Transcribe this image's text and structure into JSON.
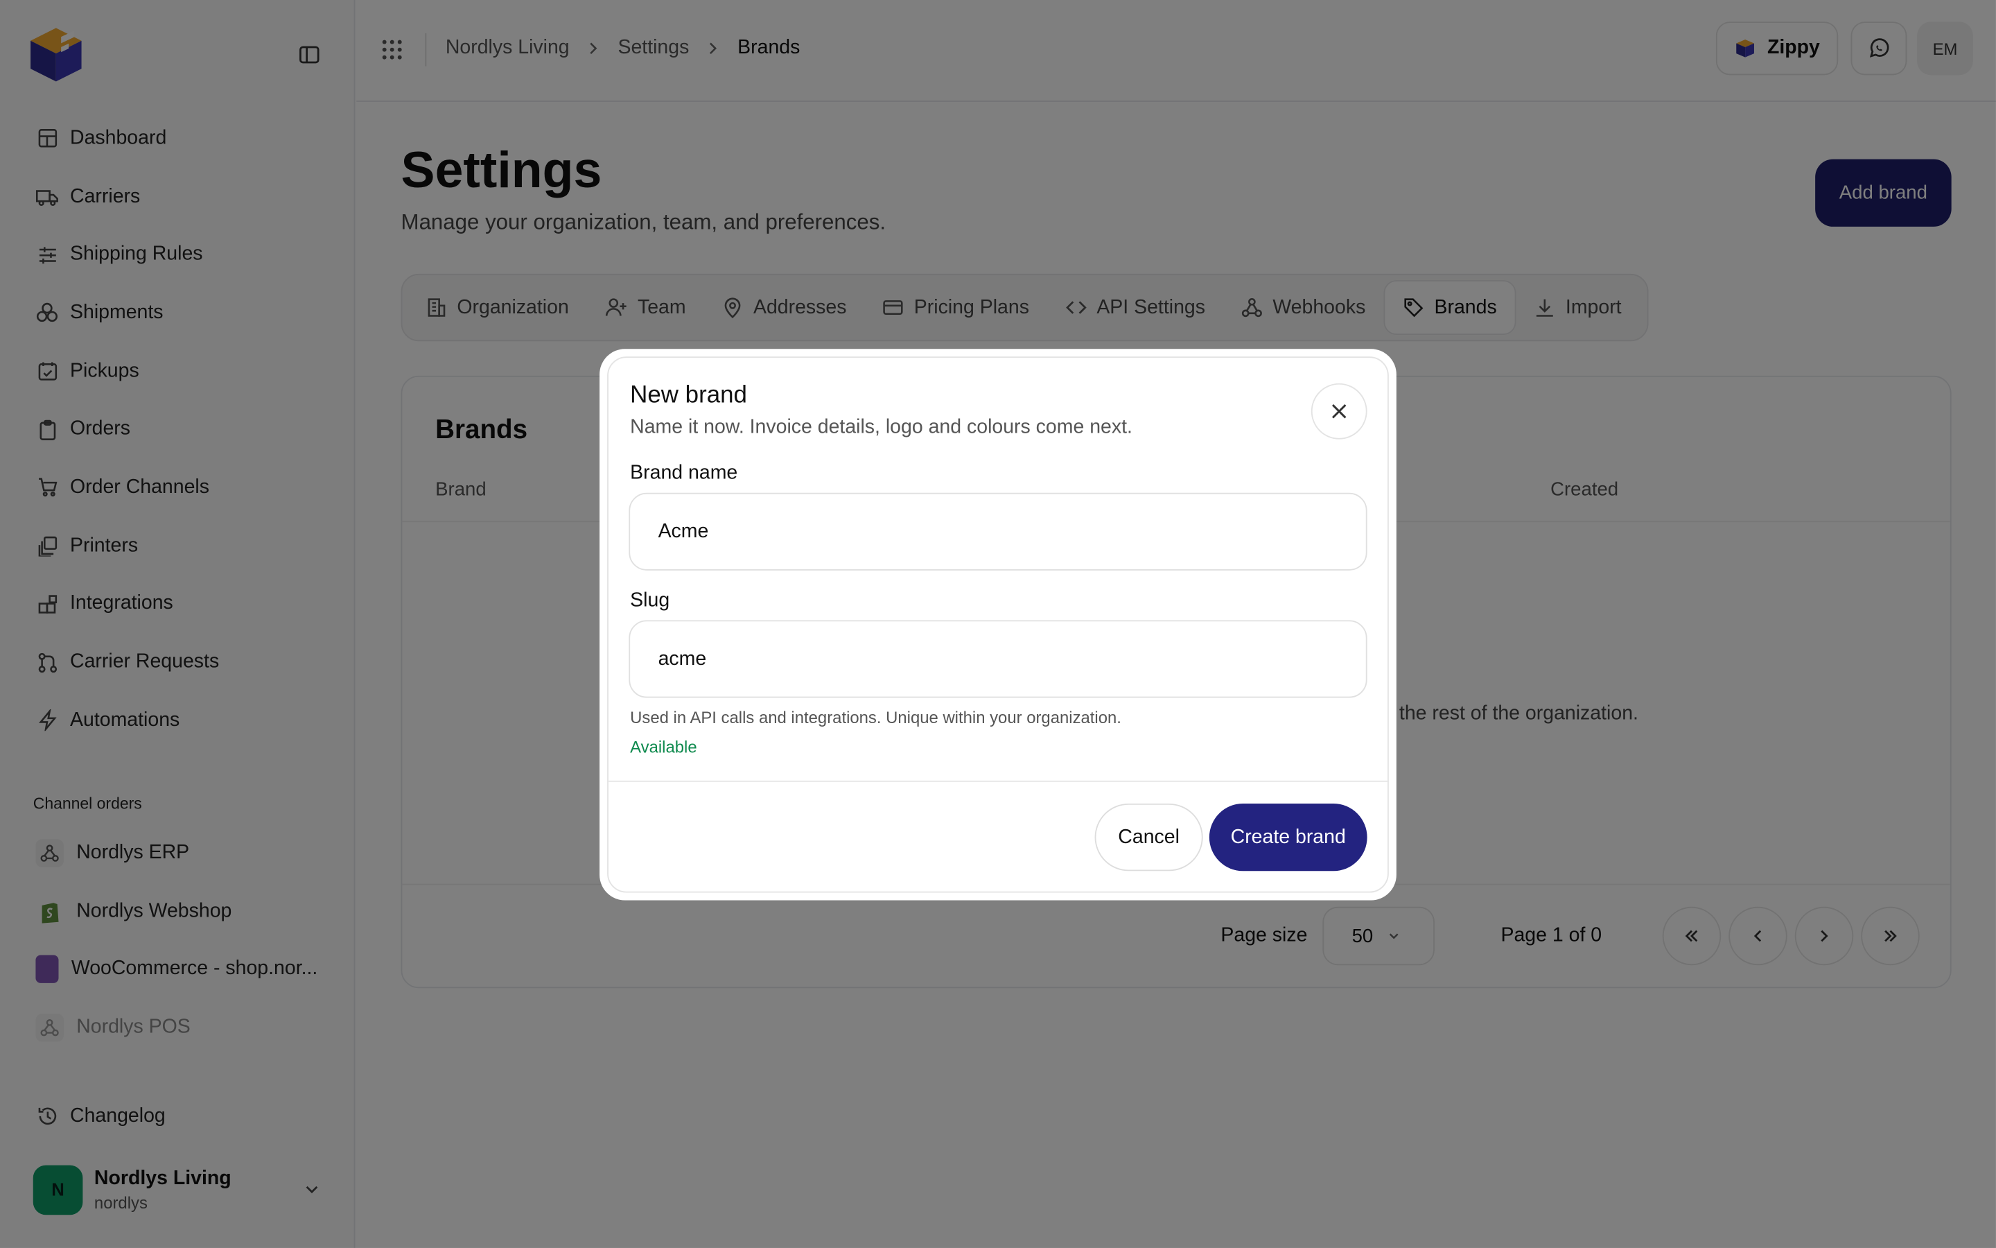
{
  "sidebar": {
    "nav": [
      {
        "label": "Dashboard",
        "icon": "dashboard-icon"
      },
      {
        "label": "Carriers",
        "icon": "truck-icon"
      },
      {
        "label": "Shipping Rules",
        "icon": "sliders-icon"
      },
      {
        "label": "Shipments",
        "icon": "boxes-icon"
      },
      {
        "label": "Pickups",
        "icon": "calendar-check-icon"
      },
      {
        "label": "Orders",
        "icon": "clipboard-icon"
      },
      {
        "label": "Order Channels",
        "icon": "cart-icon"
      },
      {
        "label": "Printers",
        "icon": "printer-icon"
      },
      {
        "label": "Integrations",
        "icon": "blocks-icon"
      },
      {
        "label": "Carrier Requests",
        "icon": "git-pull-icon"
      },
      {
        "label": "Automations",
        "icon": "bolt-icon"
      }
    ],
    "channels_label": "Channel orders",
    "channels": [
      {
        "label": "Nordlys ERP",
        "icon": "webhook-icon"
      },
      {
        "label": "Nordlys Webshop",
        "icon": "shopify-icon"
      },
      {
        "label": "WooCommerce - shop.nor...",
        "icon": "woocommerce-icon"
      },
      {
        "label": "Nordlys POS",
        "icon": "webhook-icon"
      }
    ],
    "changelog": "Changelog",
    "org": {
      "initial": "N",
      "name": "Nordlys Living",
      "slug": "nordlys"
    }
  },
  "topbar": {
    "breadcrumbs": [
      "Nordlys Living",
      "Settings",
      "Brands"
    ],
    "zippy": "Zippy",
    "user_initials": "EM"
  },
  "page": {
    "title": "Settings",
    "subtitle": "Manage your organization, team, and preferences.",
    "add_button": "Add brand"
  },
  "tabs": [
    {
      "label": "Organization",
      "icon": "building-icon"
    },
    {
      "label": "Team",
      "icon": "user-plus-icon"
    },
    {
      "label": "Addresses",
      "icon": "map-pin-icon"
    },
    {
      "label": "Pricing Plans",
      "icon": "credit-card-icon"
    },
    {
      "label": "API Settings",
      "icon": "code-icon"
    },
    {
      "label": "Webhooks",
      "icon": "webhook-icon"
    },
    {
      "label": "Brands",
      "icon": "tag-icon",
      "active": true
    },
    {
      "label": "Import",
      "icon": "download-icon"
    }
  ],
  "brands_card": {
    "title": "Brands",
    "columns": [
      "Brand",
      "Created"
    ],
    "empty_text_visible": "m the rest of the organization.",
    "page_size_label": "Page size",
    "page_size": "50",
    "page_info": "Page 1 of 0"
  },
  "modal": {
    "title": "New brand",
    "description": "Name it now. Invoice details, logo and colours come next.",
    "brand_name_label": "Brand name",
    "brand_name_value": "Acme",
    "slug_label": "Slug",
    "slug_value": "acme",
    "slug_hint": "Used in API calls and integrations. Unique within your organization.",
    "slug_status": "Available",
    "cancel": "Cancel",
    "create": "Create brand"
  },
  "colors": {
    "primary": "#232380",
    "success": "#0f8a4e",
    "avatar": "#0f9a66"
  }
}
